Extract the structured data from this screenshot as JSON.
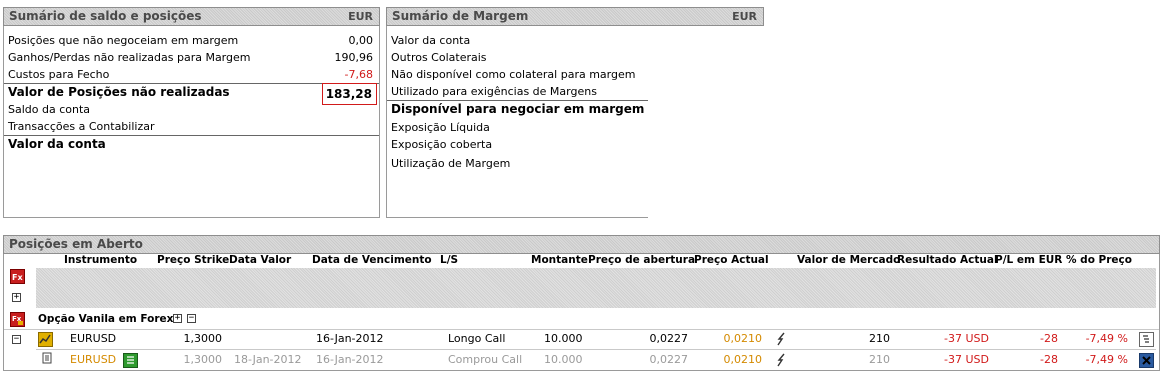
{
  "balance": {
    "title": "Sumário de saldo e posições",
    "currency": "EUR",
    "rows": [
      {
        "label": "Posições que não negoceiam em margem",
        "value": "0,00"
      },
      {
        "label": "Ganhos/Perdas não realizadas para Margem",
        "value": "190,96"
      },
      {
        "label": "Custos para Fecho",
        "value": "-7,68"
      },
      {
        "label": "Valor de Posições não realizadas",
        "value": "183,28"
      },
      {
        "label": "Saldo da conta",
        "value": ""
      },
      {
        "label": "Transacções a Contabilizar",
        "value": ""
      },
      {
        "label": "Valor da conta",
        "value": ""
      }
    ]
  },
  "margin": {
    "title": "Sumário de Margem",
    "currency": "EUR",
    "rows": [
      "Valor da conta",
      "Outros Colaterais",
      "Não disponível como colateral para margem",
      "Utilizado para exigências de Margens",
      "Disponível para negociar em margem",
      "Exposição Líquida",
      "Exposição coberta",
      "Utilização de Margem"
    ]
  },
  "open_positions": {
    "title": "Posições em Aberto",
    "columns": [
      "Instrumento",
      "Preço Strike",
      "Data Valor",
      "Data de Vencimento",
      "L/S",
      "Montante",
      "Preço de abertura",
      "Preço Actual",
      "Valor de Mercado",
      "Resultado Actual",
      "P/L em EUR",
      "% do Preço"
    ],
    "group_label": "Opção Vanila em Forex",
    "position": {
      "instrument": "EURUSD",
      "strike": "1,3000",
      "value_date": "",
      "expiry": "16-Jan-2012",
      "ls": "Longo Call",
      "amount": "10.000",
      "open_price": "0,0227",
      "current_price": "0,0210",
      "market_value": "210",
      "result": "-37 USD",
      "pl_eur": "-28",
      "pct_price": "-7,49 %"
    },
    "trade": {
      "instrument": "EURUSD",
      "strike": "1,3000",
      "value_date": "18-Jan-2012",
      "expiry": "16-Jan-2012",
      "ls": "Comprou Call",
      "amount": "10.000",
      "open_price": "0,0227",
      "current_price": "0,0210",
      "market_value": "210",
      "result": "-37 USD",
      "pl_eur": "-28",
      "pct_price": "-7,49 %"
    }
  },
  "icons": {
    "fx": "fx-icon",
    "option": "option-icon",
    "chart": "chart-icon",
    "trend": "trend-icon",
    "close": "close-icon",
    "edit": "edit-icon"
  },
  "colors": {
    "negative": "#d11a1a",
    "current_price": "#d48a00",
    "header_text": "#4a4a4a"
  }
}
